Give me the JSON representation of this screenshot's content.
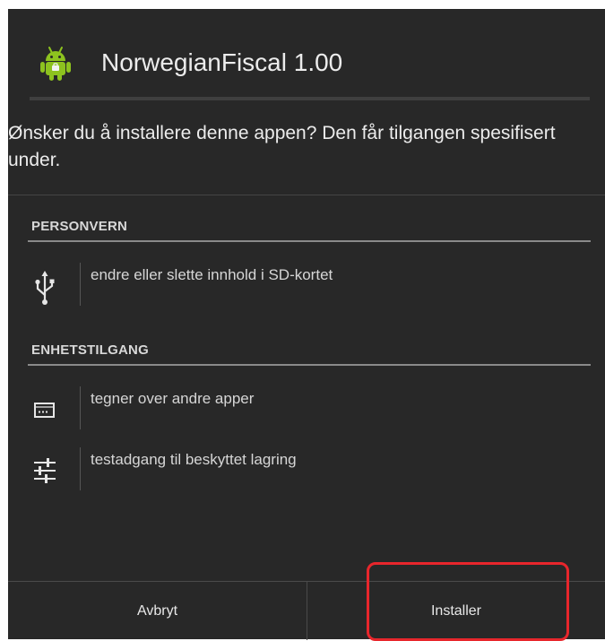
{
  "dialog": {
    "app_title": "NorwegianFiscal 1.00",
    "app_icon": "android-icon",
    "description": "Ønsker du å installere denne appen? Den får tilgangen spesifisert under."
  },
  "sections": [
    {
      "header": "PERSONVERN",
      "permissions": [
        {
          "icon": "usb-icon",
          "label": "endre eller slette innhold i SD-kortet"
        }
      ]
    },
    {
      "header": "ENHETSTILGANG",
      "permissions": [
        {
          "icon": "overlay-window-icon",
          "label": "tegner over andre apper"
        },
        {
          "icon": "settings-sliders-icon",
          "label": "testadgang til beskyttet lagring"
        }
      ]
    }
  ],
  "footer": {
    "cancel_label": "Avbryt",
    "install_label": "Installer"
  },
  "colors": {
    "background": "#282828",
    "text": "#ececec",
    "android_green": "#8dc21f",
    "highlight": "#e8262c"
  }
}
